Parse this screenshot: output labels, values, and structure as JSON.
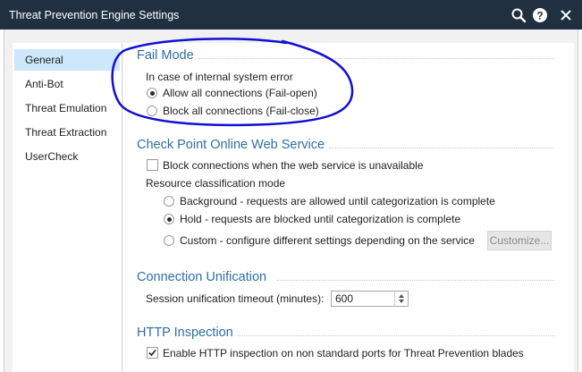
{
  "window": {
    "title": "Threat Prevention Engine Settings"
  },
  "toolbar_icons": [
    "search-icon",
    "help-icon",
    "close-icon"
  ],
  "sidebar": {
    "items": [
      {
        "label": "General",
        "active": true
      },
      {
        "label": "Anti-Bot",
        "active": false
      },
      {
        "label": "Threat Emulation",
        "active": false
      },
      {
        "label": "Threat Extraction",
        "active": false
      },
      {
        "label": "UserCheck",
        "active": false
      }
    ]
  },
  "fail_mode": {
    "title": "Fail Mode",
    "description": "In case of internal system error",
    "options": [
      {
        "label": "Allow all connections (Fail-open)",
        "selected": true
      },
      {
        "label": "Block all connections (Fail-close)",
        "selected": false
      }
    ]
  },
  "web_service": {
    "title": "Check Point Online Web Service",
    "block_checkbox": {
      "label": "Block connections when the web service is unavailable",
      "checked": false
    },
    "classification_label": "Resource classification mode",
    "modes": [
      {
        "label": "Background - requests are allowed until categorization is complete",
        "selected": false
      },
      {
        "label": "Hold - requests are blocked until categorization is complete",
        "selected": true
      },
      {
        "label": "Custom - configure different settings depending on the service",
        "selected": false
      }
    ],
    "customize_button": "Customize..."
  },
  "connection_unification": {
    "title": "Connection Unification",
    "timeout_label": "Session unification timeout (minutes):",
    "timeout_value": "600"
  },
  "http_inspection": {
    "title": "HTTP Inspection",
    "checkbox": {
      "label": "Enable HTTP inspection on non standard ports for Threat Prevention blades",
      "checked": true
    }
  },
  "colors": {
    "titlebar": "#203040",
    "section_title": "#2f6ea5",
    "sidebar_active": "#cde8fb",
    "annotation_ink": "#1010d0"
  }
}
